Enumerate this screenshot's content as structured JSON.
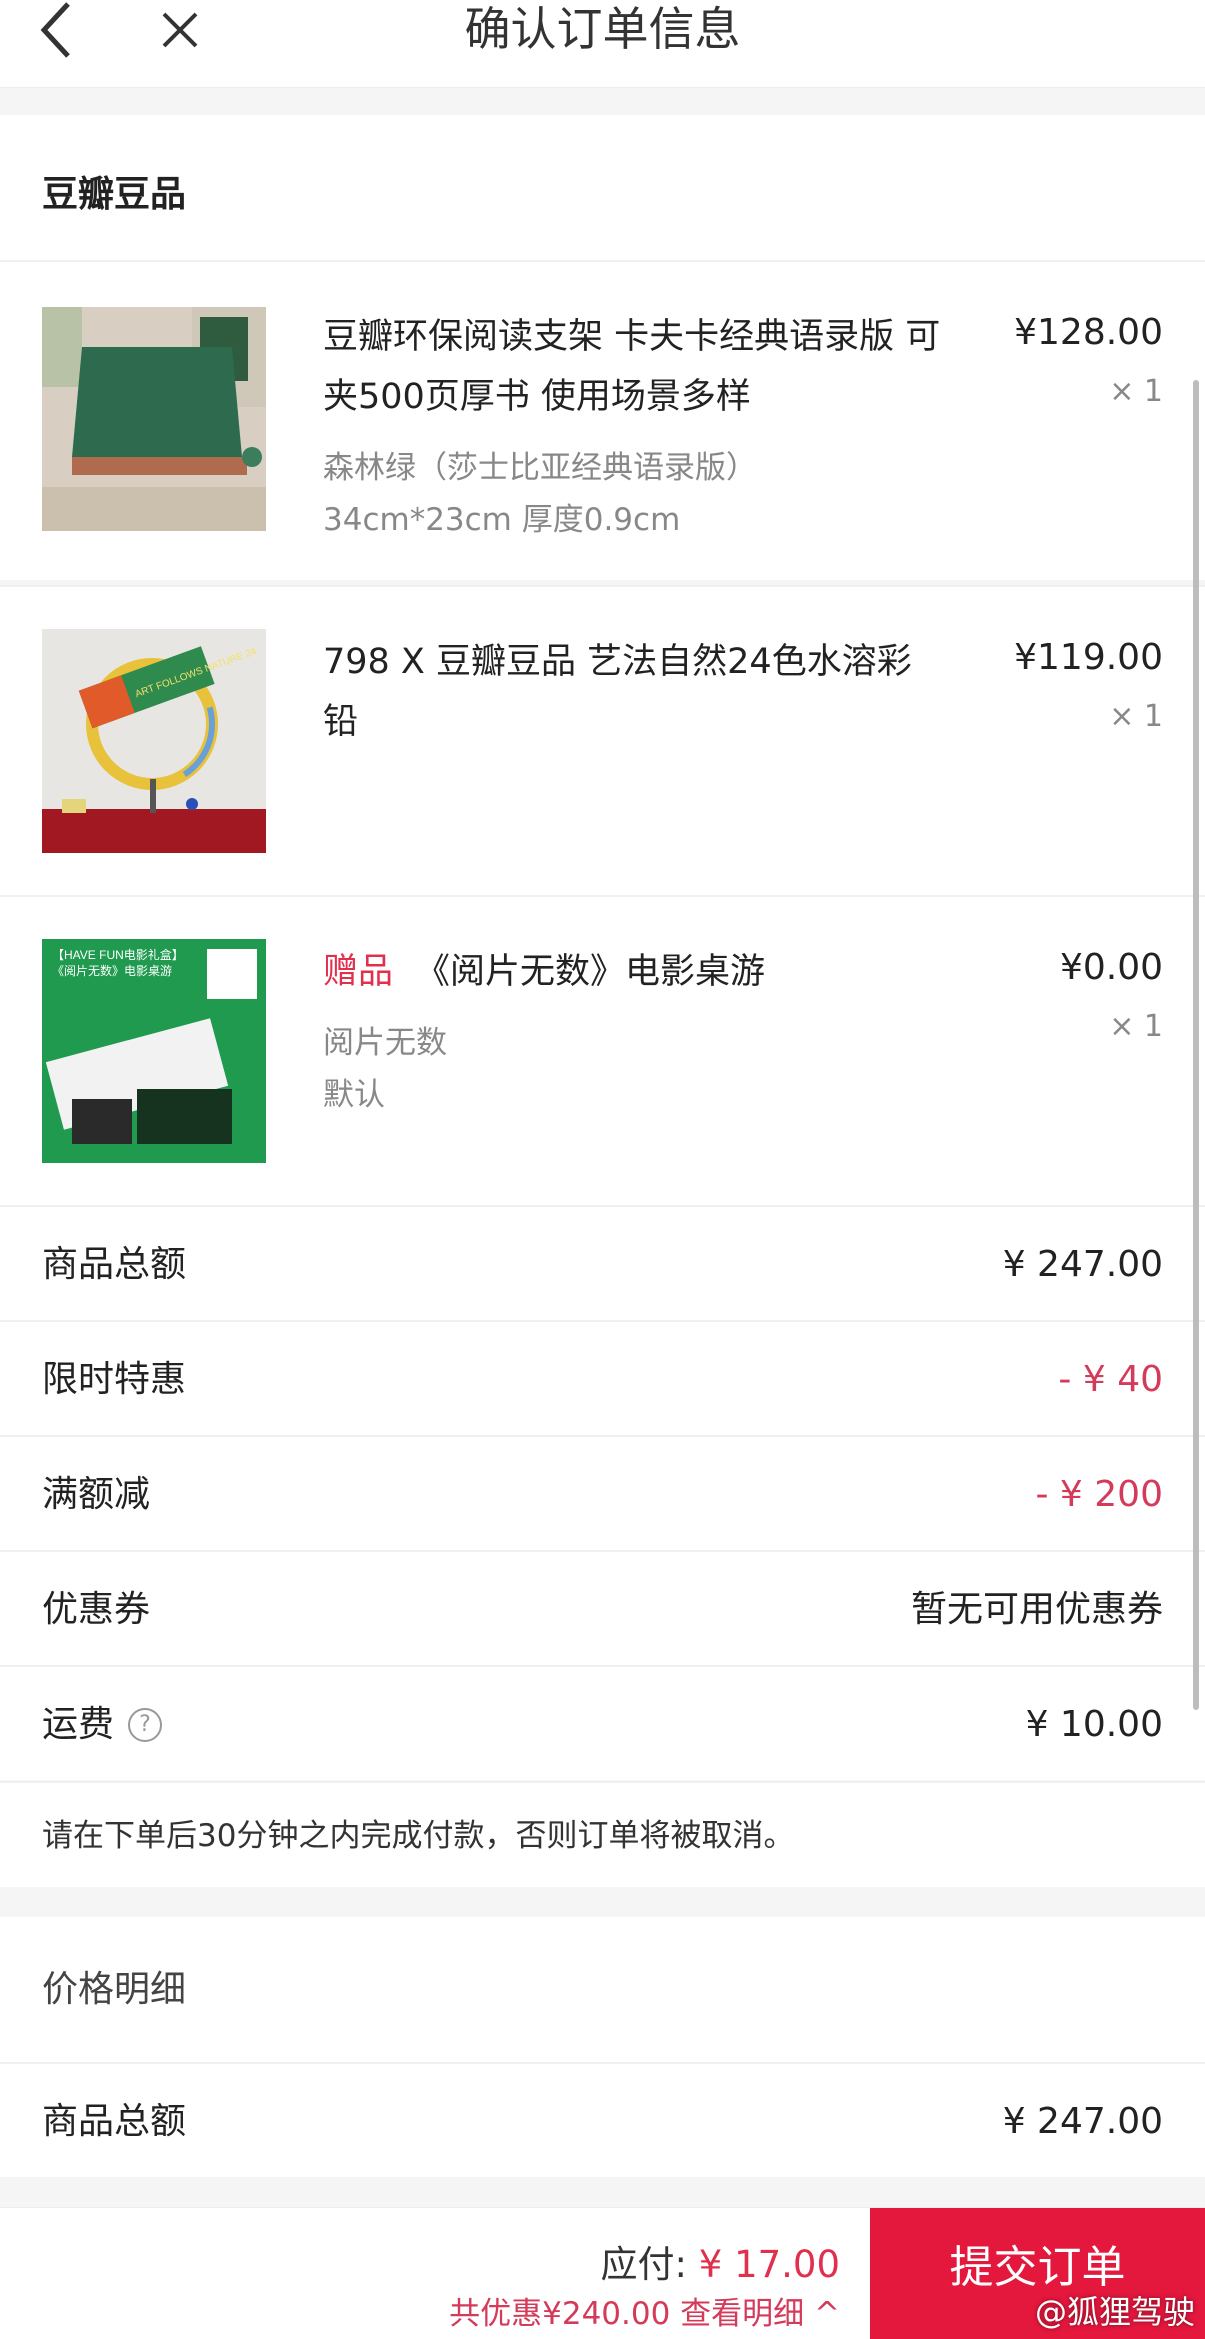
{
  "nav": {
    "title": "确认订单信息"
  },
  "shop": {
    "name": "豆瓣豆品"
  },
  "items": [
    {
      "title": "豆瓣环保阅读支架 卡夫卡经典语录版 可夹500页厚书 使用场景多样",
      "price": "¥128.00",
      "qty": "× 1",
      "spec1": "森林绿（莎士比亚经典语录版）",
      "spec2": "34cm*23cm 厚度0.9cm"
    },
    {
      "title": "798 X 豆瓣豆品 艺法自然24色水溶彩铅",
      "price": "¥119.00",
      "qty": "× 1",
      "thumb_text": "ART FOLLOWS NATURE 24"
    },
    {
      "gift_tag": "赠品",
      "title": "《阅片无数》电影桌游",
      "price": "¥0.00",
      "qty": "× 1",
      "spec1": "阅片无数",
      "spec2": "默认",
      "thumb_line1": "【HAVE FUN电影礼盒】",
      "thumb_line2": "《阅片无数》电影桌游"
    }
  ],
  "summary": {
    "goods_total_label": "商品总额",
    "goods_total": "¥ 247.00",
    "limited_label": "限时特惠",
    "limited": "- ¥ 40",
    "full_reduce_label": "满额减",
    "full_reduce": "- ¥ 200",
    "coupon_label": "优惠券",
    "coupon": "暂无可用优惠券",
    "shipping_label": "运费",
    "shipping": "¥ 10.00"
  },
  "notice": "请在下单后30分钟之内完成付款，否则订单将被取消。",
  "price_detail": {
    "title": "价格明细",
    "goods_total_label": "商品总额",
    "goods_total": "¥ 247.00"
  },
  "bottom": {
    "pay_label": "应付:",
    "pay_amount": "¥ 17.00",
    "saving": "共优惠¥240.00 查看明细 ^",
    "submit": "提交订单",
    "watermark": "@狐狸驾驶"
  },
  "colors": {
    "accent": "#e4173d",
    "discount": "#d43a5a"
  }
}
